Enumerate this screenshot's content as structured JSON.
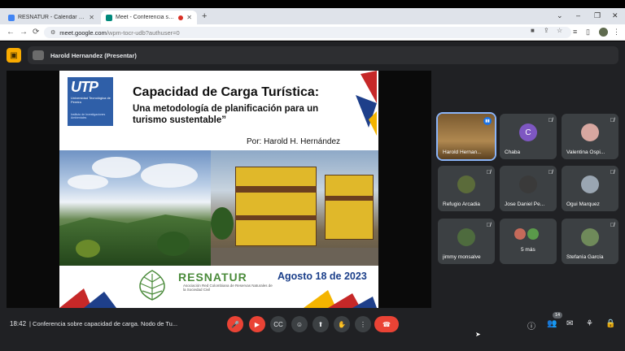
{
  "browser": {
    "tabs": [
      {
        "title": "RESNATUR - Calendar - jueves, 1",
        "close": "✕"
      },
      {
        "title": "Meet - Conferencia sobre ca",
        "close": "✕"
      }
    ],
    "new_tab": "+",
    "window_controls": {
      "collapse": "⌄",
      "minimize": "–",
      "maximize": "❐",
      "close": "✕"
    },
    "address": {
      "domain": "meet.google.com",
      "path": "/wpm-tocr-udb?authuser=0"
    }
  },
  "meet": {
    "presenter_label": "Harold Hernandez (Presentar)",
    "slide": {
      "logo_text": "UTP",
      "logo_university": "Universidad Tecnológica de Pereira",
      "logo_institute": "Instituto de Investigaciones Ambientales",
      "title": "Capacidad de Carga Turística:",
      "subtitle": "Una metodología de planificación para un turismo sustentable”",
      "author": "Por: Harold H. Hernández",
      "org_name": "RESNATUR",
      "org_sub": "Asociación Red Colombiana de Reservas Naturales de la Sociedad Civil",
      "date": "Agosto 18 de 2023"
    },
    "participants": [
      {
        "name": "Harold Hernan...",
        "initial": "",
        "avatar_color": "#8a6a3a",
        "speaking": true
      },
      {
        "name": "Chaba",
        "initial": "C",
        "avatar_color": "#7e57c2",
        "speaking": false
      },
      {
        "name": "Valentina Ospi...",
        "initial": "",
        "avatar_color": "#d7a7a0",
        "speaking": false
      },
      {
        "name": "Refugio Arcadia",
        "initial": "",
        "avatar_color": "#5b6b3a",
        "speaking": false
      },
      {
        "name": "Jose Daniel Pe...",
        "initial": "",
        "avatar_color": "#3a3a3a",
        "speaking": false
      },
      {
        "name": "Ogui Marquez",
        "initial": "",
        "avatar_color": "#9aa6b2",
        "speaking": false
      },
      {
        "name": "jimmy monsalve",
        "initial": "",
        "avatar_color": "#4e6b3e",
        "speaking": false
      },
      {
        "name": "5 más",
        "initial": "",
        "avatar_color": "#c56a5a",
        "speaking": false
      },
      {
        "name": "Stefanía García",
        "initial": "",
        "avatar_color": "#6f8a5a",
        "speaking": false
      }
    ]
  },
  "bottom_bar": {
    "time": "18:42",
    "separator": "|",
    "meeting_title": "Conferencia sobre capacidad de carga. Nodo de Tu...",
    "people_count": "14"
  }
}
